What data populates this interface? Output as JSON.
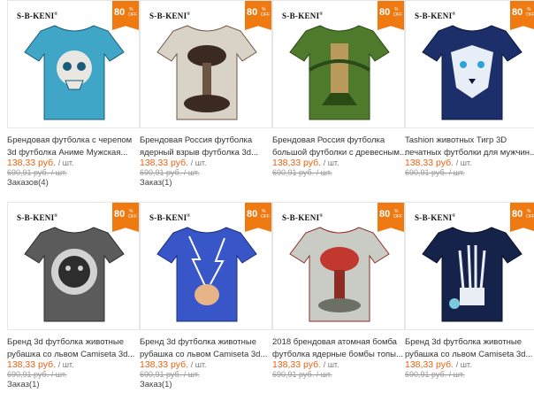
{
  "brand": "S-B-KENI",
  "brand_mark": "®",
  "badge": {
    "value": "80",
    "percent": "%",
    "off": "OFF"
  },
  "products": [
    {
      "title": "Брендовая футболка с черепом 3d футболка Аниме Мужская...",
      "price": "138,33 руб.",
      "unit": "/ шт.",
      "old_price": "690,91 руб. / шт.",
      "orders": "Заказов(4)",
      "colors": {
        "bg": "#f4f4f4",
        "shirt": "#3fa6c8",
        "accent": "#1b5c78",
        "print": "#e9e7e1"
      }
    },
    {
      "title": "Брендовая Россия футболка ядерный взрыв футболка 3d...",
      "price": "138,33 руб.",
      "unit": "/ шт.",
      "old_price": "690,91 руб. / шт.",
      "orders": "Заказ(1)",
      "colors": {
        "bg": "#f4f4f4",
        "shirt": "#d9d2c6",
        "accent": "#6d5544",
        "print": "#3b2a21"
      }
    },
    {
      "title": "Брендовая Россия футболка большой футболки с древесным...",
      "price": "138,33 руб.",
      "unit": "/ шт.",
      "old_price": "690,91 руб. / шт.",
      "orders": "",
      "colors": {
        "bg": "#f4f4f4",
        "shirt": "#4f7a2c",
        "accent": "#2a4a16",
        "print": "#b99a5b"
      }
    },
    {
      "title": "Tashion животных Тигр 3D печатных футболки для мужчин...",
      "price": "138,33 руб.",
      "unit": "/ шт.",
      "old_price": "690,91 руб. / шт.",
      "orders": "",
      "colors": {
        "bg": "#f4f4f4",
        "shirt": "#1d2f6a",
        "accent": "#0d1838",
        "print": "#e8eef7"
      }
    },
    {
      "title": "Бренд 3d футболка животные рубашка со львом Camiseta 3d...",
      "price": "138,33 руб.",
      "unit": "/ шт.",
      "old_price": "690,91 руб. / шт.",
      "orders": "Заказ(1)",
      "colors": {
        "bg": "#f4f4f4",
        "shirt": "#5b5b5b",
        "accent": "#2d2d2d",
        "print": "#d2d2d2"
      }
    },
    {
      "title": "Бренд 3d футболка животные рубашка со львом Camiseta 3d...",
      "price": "138,33 руб.",
      "unit": "/ шт.",
      "old_price": "690,91 руб. / шт.",
      "orders": "Заказ(1)",
      "colors": {
        "bg": "#f4f4f4",
        "shirt": "#3856c8",
        "accent": "#1b2d7a",
        "print": "#e7b487"
      }
    },
    {
      "title": "2018 брендовая атомная бомба футболка ядерные бомбы топы...",
      "price": "138,33 руб.",
      "unit": "/ шт.",
      "old_price": "690,91 руб. / шт.",
      "orders": "",
      "colors": {
        "bg": "#f4f4f4",
        "shirt": "#c9ccc5",
        "accent": "#8e2b24",
        "print": "#c2372e"
      }
    },
    {
      "title": "Бренд 3d футболка животные рубашка со львом Camiseta 3d...",
      "price": "138,33 руб.",
      "unit": "/ шт.",
      "old_price": "690,91 руб. / шт.",
      "orders": "",
      "colors": {
        "bg": "#f4f4f4",
        "shirt": "#15224a",
        "accent": "#0a1128",
        "print": "#7cc8df"
      }
    }
  ]
}
